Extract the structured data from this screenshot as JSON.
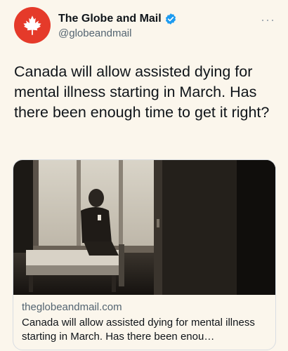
{
  "account": {
    "display_name": "The Globe and Mail",
    "handle": "@globeandmail",
    "avatar_icon": "maple-leaf-icon",
    "avatar_color": "#e53a2a",
    "verified_color": "#1d9bf0"
  },
  "tweet": {
    "text": "Canada will allow assisted dying for mental illness starting in March. Has there been enough time to get it right?"
  },
  "card": {
    "domain": "theglobeandmail.com",
    "title": "Canada will allow assisted dying for mental illness starting in March. Has there been enou…"
  },
  "menu": {
    "more_label": "···"
  }
}
